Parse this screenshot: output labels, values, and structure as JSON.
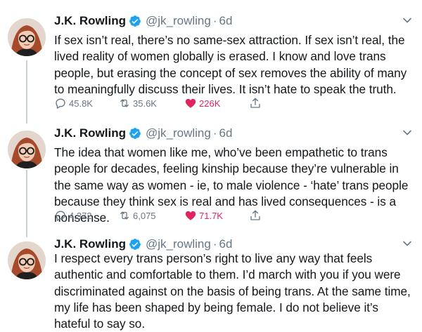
{
  "tweets": [
    {
      "author": "J.K. Rowling",
      "handle": "@jk_rowling",
      "separator": "·",
      "time": "6d",
      "text": "If sex isn’t real, there’s no same-sex attraction. If sex isn’t real, the lived reality of women globally is erased. I know and love trans people, but erasing the concept of sex removes the ability of many to meaningfully discuss their lives. It isn’t hate to speak the truth.",
      "replies": "45.8K",
      "retweets": "35.6K",
      "likes": "226K",
      "liked": true
    },
    {
      "author": "J.K. Rowling",
      "handle": "@jk_rowling",
      "separator": "·",
      "time": "6d",
      "text": "The idea that women like me, who’ve been empathetic to trans people for decades, feeling kinship because they’re vulnerable in the same way as women - ie, to male violence - ‘hate’ trans people because they think sex is real and has lived consequences - is a nonsense.",
      "replies": "4,372",
      "retweets": "6,075",
      "likes": "71.7K",
      "liked": true
    },
    {
      "author": "J.K. Rowling",
      "handle": "@jk_rowling",
      "separator": "·",
      "time": "6d",
      "text": "I respect every trans person’s right to live any way that feels authentic and comfortable to them. I’d march with you if you were discriminated against on the basis of being trans. At the same time, my life has been shaped by being female. I do not believe it’s hateful to say so."
    }
  ],
  "colors": {
    "text": "#14171a",
    "secondary": "#657786",
    "like": "#e0245e",
    "verified": "#1da1f2",
    "thread_line": "#c4cfd6"
  },
  "icons": [
    "verified-badge-icon",
    "chevron-down-icon",
    "reply-icon",
    "retweet-icon",
    "heart-icon",
    "share-icon"
  ]
}
